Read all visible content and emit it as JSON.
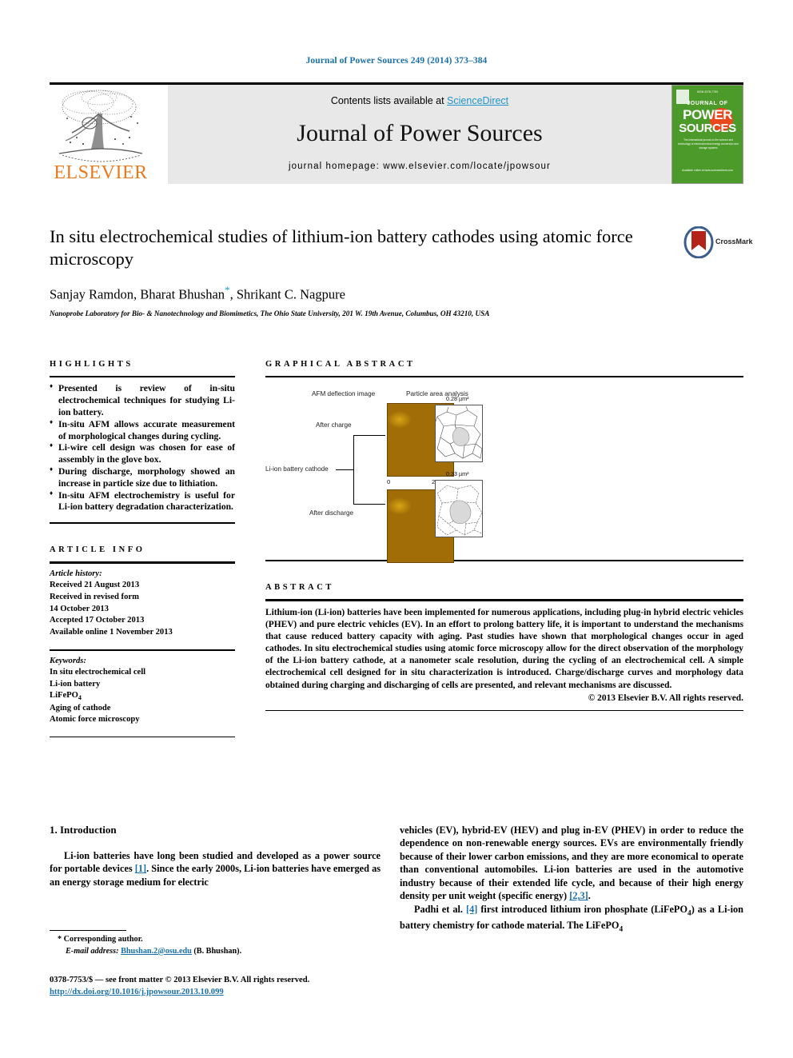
{
  "running_head": "Journal of Power Sources 249 (2014) 373–384",
  "banner": {
    "contents_prefix": "Contents lists available at ",
    "sciencedirect": "ScienceDirect",
    "journal_title": "Journal of Power Sources",
    "homepage": "journal homepage: www.elsevier.com/locate/jpowsour",
    "publisher_logo_text": "ELSEVIER",
    "cover": {
      "top_text": "ISSN 0378-7753",
      "journal_of": "JOURNAL OF",
      "power": "POWER",
      "sources": "SOURCES",
      "blurb": "The international journal on the science and technology of electrochemical energy conversion and storage systems",
      "bottom": "Available online at www.sciencedirect.com"
    },
    "accent_link_color": "#2196c8",
    "cover_bg_color": "#4c9a2a",
    "cover_circle_color": "#e8481c",
    "elsevier_orange": "#e87a1e"
  },
  "article": {
    "title": "In situ electrochemical studies of lithium-ion battery cathodes using atomic force microscopy",
    "authors": "Sanjay Ramdon, Bharat Bhushan",
    "authors_tail": ", Shrikant C. Nagpure",
    "corresponding_marker": "*",
    "affiliation": "Nanoprobe Laboratory for Bio- & Nanotechnology and Biomimetics, The Ohio State University, 201 W. 19th Avenue, Columbus, OH 43210, USA",
    "crossmark_label": "CrossMark"
  },
  "highlights": {
    "heading": "HIGHLIGHTS",
    "items": [
      "Presented is review of in-situ electrochemical techniques for studying Li-ion battery.",
      "In-situ AFM allows accurate measurement of morphological changes during cycling.",
      "Li-wire cell design was chosen for ease of assembly in the glove box.",
      "During discharge, morphology showed an increase in particle size due to lithiation.",
      "In-situ AFM electrochemistry is useful for Li-ion battery degradation characterization."
    ]
  },
  "article_info": {
    "heading": "ARTICLE INFO",
    "history_label": "Article history:",
    "history": [
      "Received 21 August 2013",
      "Received in revised form",
      "14 October 2013",
      "Accepted 17 October 2013",
      "Available online 1 November 2013"
    ],
    "keywords_label": "Keywords:",
    "keywords": [
      "In situ electrochemical cell",
      "Li-ion battery",
      "LiFePO4",
      "Aging of cathode",
      "Atomic force microscopy"
    ]
  },
  "graphical_abstract": {
    "heading": "GRAPHICAL ABSTRACT",
    "col_label_1": "AFM deflection image",
    "col_label_2": "Particle area analysis",
    "row_label_1": "After charge",
    "row_label_2": "After discharge",
    "root_label": "Li-ion battery cathode",
    "scale_zero": "0",
    "scale_max": "2 µm",
    "area_charge": "0.28 µm²",
    "area_discharge": "0.33 µm²"
  },
  "abstract": {
    "heading": "ABSTRACT",
    "text": "Lithium-ion (Li-ion) batteries have been implemented for numerous applications, including plug-in hybrid electric vehicles (PHEV) and pure electric vehicles (EV). In an effort to prolong battery life, it is important to understand the mechanisms that cause reduced battery capacity with aging. Past studies have shown that morphological changes occur in aged cathodes. In situ electrochemical studies using atomic force microscopy allow for the direct observation of the morphology of the Li-ion battery cathode, at a nanometer scale resolution, during the cycling of an electrochemical cell. A simple electrochemical cell designed for in situ characterization is introduced. Charge/discharge curves and morphology data obtained during charging and discharging of cells are presented, and relevant mechanisms are discussed.",
    "copyright": "© 2013 Elsevier B.V. All rights reserved."
  },
  "body": {
    "section_heading": "1. Introduction",
    "left_para_1a": "Li-ion batteries have long been studied and developed as a power source for portable devices ",
    "left_ref_1": "[1]",
    "left_para_1b": ". Since the early 2000s, Li-ion batteries have emerged as an energy storage medium for electric",
    "right_para_1a": "vehicles (EV), hybrid-EV (HEV) and plug in-EV (PHEV) in order to reduce the dependence on non-renewable energy sources. EVs are environmentally friendly because of their lower carbon emissions, and they are more economical to operate than conventional automobiles. Li-ion batteries are used in the automotive industry because of their extended life cycle, and because of their high energy density per unit weight (specific energy) ",
    "right_ref_1": "[2,3]",
    "right_para_1b": ".",
    "right_para_2a": "Padhi et al. ",
    "right_ref_2": "[4]",
    "right_para_2b": " first introduced lithium iron phosphate (LiFePO",
    "right_para_2c": ") as a Li-ion battery chemistry for cathode material. The LiFePO",
    "subscript_4": "4"
  },
  "footnote": {
    "corresponding": "* Corresponding author.",
    "email_label": "E-mail address:",
    "email": "Bhushan.2@osu.edu",
    "email_owner": "(B. Bhushan)."
  },
  "footer": {
    "issn_line": "0378-7753/$ — see front matter © 2013 Elsevier B.V. All rights reserved.",
    "doi": "http://dx.doi.org/10.1016/j.jpowsour.2013.10.099"
  }
}
